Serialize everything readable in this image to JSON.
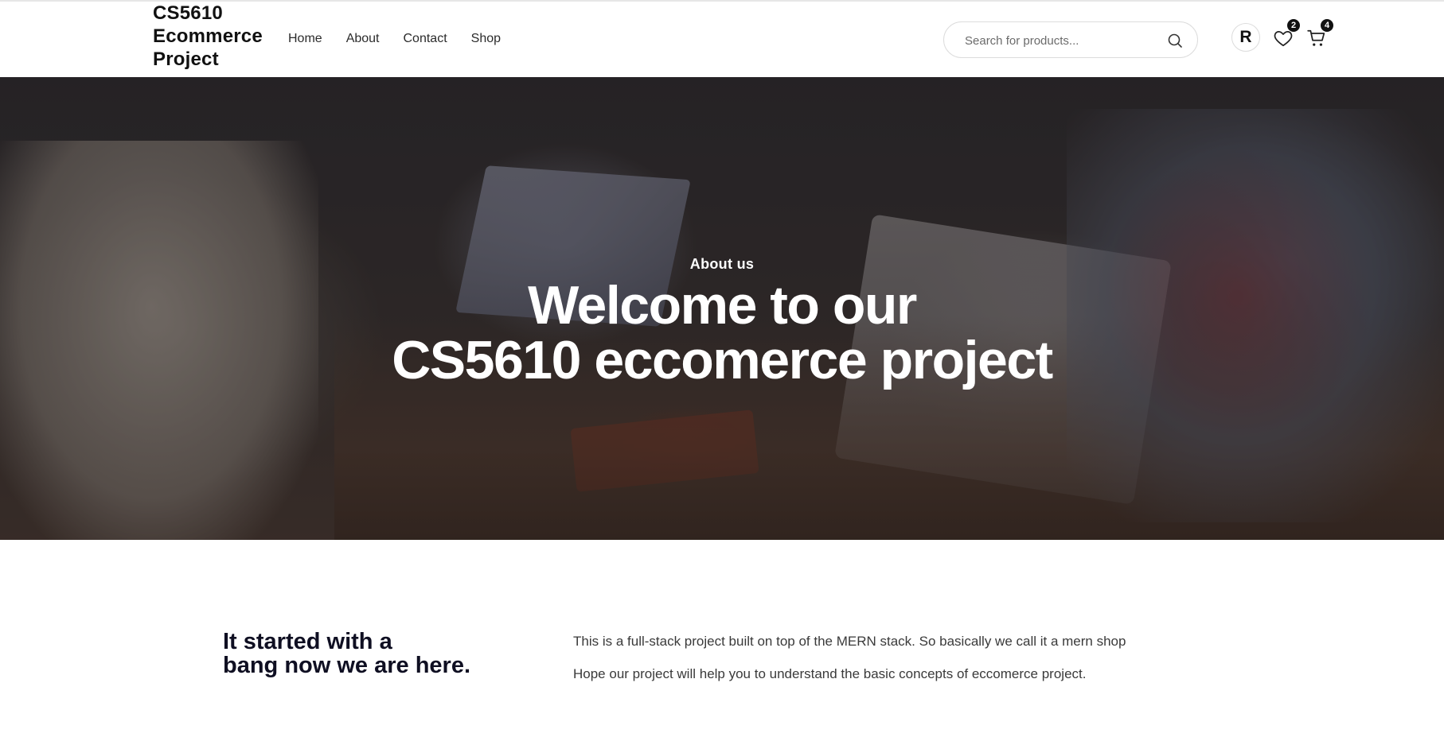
{
  "header": {
    "brand_line1": "CS5610",
    "brand_line2": "Ecommerce",
    "brand_line3": "Project",
    "nav": [
      "Home",
      "About",
      "Contact",
      "Shop"
    ],
    "search_placeholder": "Search for products...",
    "search_icon": "search-icon",
    "avatar_letter": "R",
    "wishlist_icon": "heart-icon",
    "wishlist_count": "2",
    "cart_icon": "cart-icon",
    "cart_count": "4"
  },
  "hero": {
    "eyebrow": "About us",
    "title_line1": "Welcome to our",
    "title_line2": "CS5610 eccomerce project"
  },
  "intro": {
    "heading_line1": "It started with a",
    "heading_line2": "bang now we are here.",
    "paragraph1": "This is a full-stack project built on top of the MERN stack. So basically we call it a mern shop",
    "paragraph2": "Hope our project will help you to understand the basic concepts of eccomerce project."
  },
  "colors": {
    "text_dark": "#0f0f22",
    "badge_bg": "#111111",
    "hero_text": "#ffffff"
  }
}
